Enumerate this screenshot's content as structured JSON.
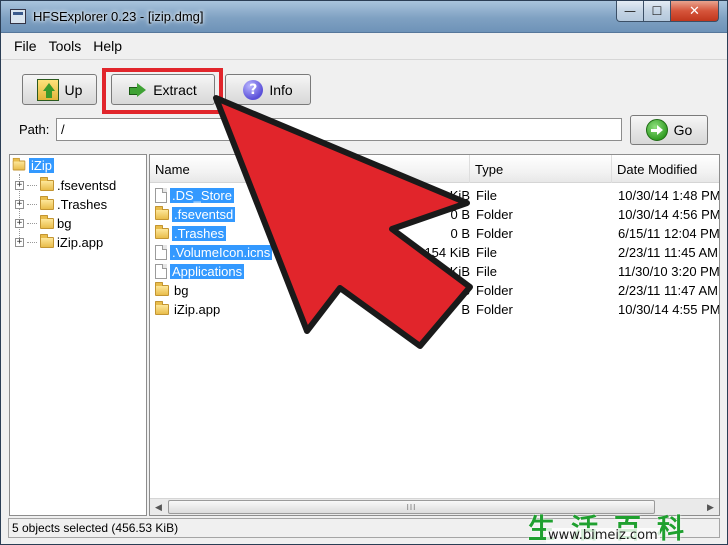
{
  "window": {
    "title": "HFSExplorer 0.23 - [izip.dmg]",
    "controls": {
      "minimize": "—",
      "maximize": "☐",
      "close": "✕"
    }
  },
  "menu": [
    "File",
    "Tools",
    "Help"
  ],
  "toolbar": {
    "up_label": "Up",
    "extract_label": "Extract",
    "info_label": "Info",
    "highlight_color": "#e1252b"
  },
  "path": {
    "label": "Path:",
    "value": "/",
    "go_label": "Go"
  },
  "tree": {
    "root": "iZip",
    "items": [
      ".fseventsd",
      ".Trashes",
      "bg",
      "iZip.app"
    ]
  },
  "filelist": {
    "columns": {
      "name": "Name",
      "type": "Type",
      "date": "Date Modified"
    },
    "rows": [
      {
        "name": ".DS_Store",
        "size": "3 KiB",
        "type": "File",
        "date": "10/30/14 1:48 PM",
        "icon": "file-icon",
        "selected": true
      },
      {
        "name": ".fseventsd",
        "size": "0 B",
        "type": "Folder",
        "date": "10/30/14 4:56 PM",
        "icon": "folder-icon",
        "selected": true
      },
      {
        "name": ".Trashes",
        "size": "0 B",
        "type": "Folder",
        "date": "6/15/11 12:04 PM",
        "icon": "folder-icon",
        "selected": true
      },
      {
        "name": ".VolumeIcon.icns",
        "size": "154 KiB",
        "type": "File",
        "date": "2/23/11 11:45 AM",
        "icon": "file-icon",
        "selected": true
      },
      {
        "name": "Applications",
        "size": "4 KiB",
        "type": "File",
        "date": "11/30/10 3:20 PM",
        "icon": "file-icon",
        "selected": true
      },
      {
        "name": "bg",
        "size": "B",
        "type": "Folder",
        "date": "2/23/11 11:47 AM",
        "icon": "folder-icon",
        "selected": false
      },
      {
        "name": "iZip.app",
        "size": "B",
        "type": "Folder",
        "date": "10/30/14 4:55 PM",
        "icon": "folder-icon",
        "selected": false
      }
    ]
  },
  "scrollbar": {
    "left_arrow": "◀",
    "right_arrow": "▶",
    "grip": "III"
  },
  "status": "5 objects selected (456.53 KiB)",
  "annotation": {
    "arrow_color": "#e1252b"
  },
  "watermark": {
    "glyphs": "生活百科",
    "url": "www.bimeiz.com"
  }
}
